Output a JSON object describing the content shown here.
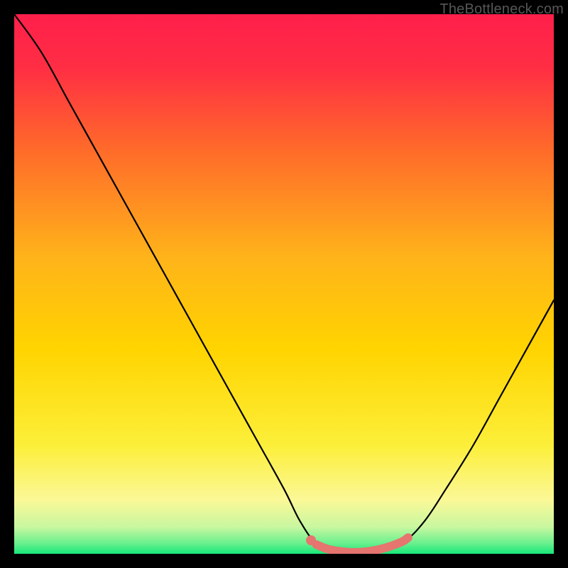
{
  "watermark": "TheBottleneck.com",
  "chart_data": {
    "type": "line",
    "title": "",
    "xlabel": "",
    "ylabel": "",
    "xlim": [
      0,
      100
    ],
    "ylim": [
      0,
      100
    ],
    "series": [
      {
        "name": "bottleneck-curve",
        "x": [
          0,
          5,
          10,
          15,
          20,
          25,
          30,
          35,
          40,
          45,
          50,
          53,
          56,
          60,
          64,
          68,
          72,
          76,
          80,
          85,
          90,
          95,
          100
        ],
        "y": [
          100,
          93,
          84,
          75,
          66,
          57,
          48,
          39,
          30,
          21,
          12,
          6,
          2,
          0.5,
          0,
          0.5,
          2,
          6,
          12,
          20,
          29,
          38,
          47
        ]
      },
      {
        "name": "plateau-marker",
        "x": [
          56,
          58,
          60,
          62,
          64,
          66,
          68,
          70,
          72,
          73
        ],
        "y": [
          1.7,
          0.9,
          0.5,
          0.3,
          0.3,
          0.5,
          0.9,
          1.5,
          2.3,
          3.0
        ]
      }
    ],
    "marker_point": {
      "x": 55,
      "y": 2.5
    },
    "colors": {
      "curve": "#000000",
      "marker": "#e6746f",
      "gradient_top": "#ff1f4b",
      "gradient_mid": "#ffd400",
      "gradient_low": "#fff99a",
      "gradient_bottom": "#17e87a"
    }
  }
}
